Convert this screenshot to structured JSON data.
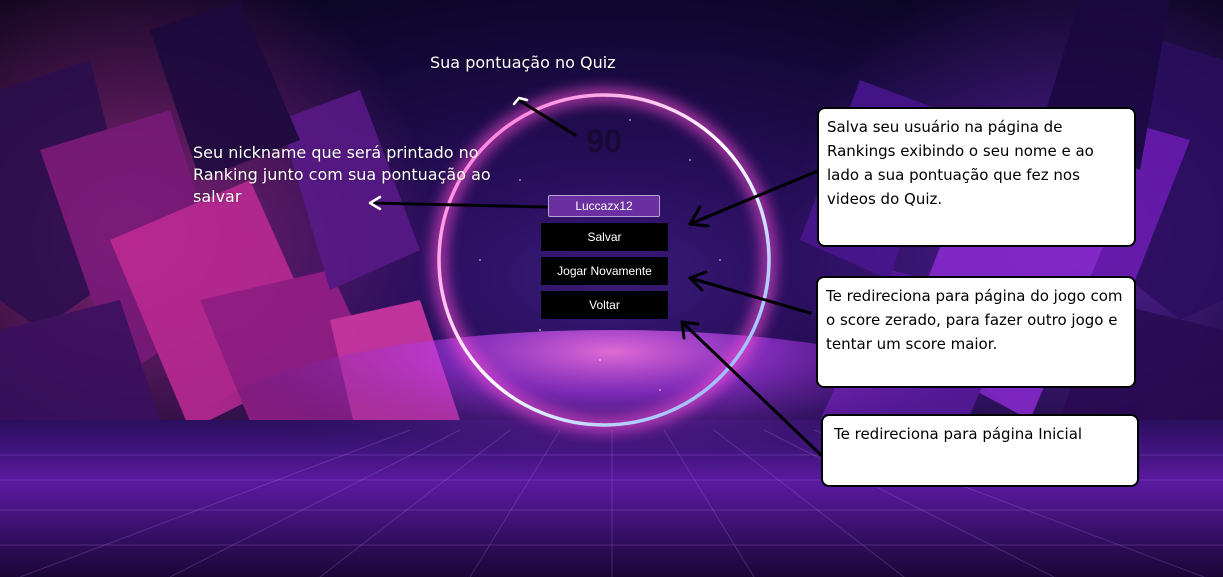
{
  "score_label": "Sua pontuação no Quiz",
  "score_value": "90",
  "nickname_annotation": "Seu nickname que será printado no Ranking junto com sua pontuação ao salvar",
  "nickname_input": {
    "value": "Luccazx12"
  },
  "buttons": {
    "save": "Salvar",
    "play_again": "Jogar Novamente",
    "back": "Voltar"
  },
  "callouts": {
    "save": "Salva seu usuário na página de Rankings exibindo o seu nome e ao lado a sua pontuação que fez nos videos do Quiz.",
    "play_again": "Te redireciona para página do jogo com o score zerado, para fazer outro jogo e tentar um score maior.",
    "back": "Te redireciona para página Inicial"
  },
  "colors": {
    "ring_glow": "#ff4fd8",
    "ring_core": "#ffffff",
    "button_bg": "#000000",
    "input_bg": "#6a2fa1",
    "callout_bg": "#ffffff"
  }
}
